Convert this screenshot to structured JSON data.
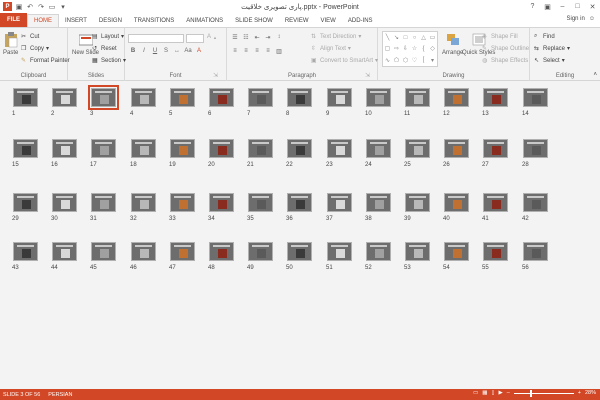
{
  "window": {
    "title": "پاری تصویری خلاقیت.pptx - PowerPoint"
  },
  "tabs": [
    {
      "label": "FILE"
    },
    {
      "label": "HOME"
    },
    {
      "label": "INSERT"
    },
    {
      "label": "DESIGN"
    },
    {
      "label": "TRANSITIONS"
    },
    {
      "label": "ANIMATIONS"
    },
    {
      "label": "SLIDE SHOW"
    },
    {
      "label": "REVIEW"
    },
    {
      "label": "VIEW"
    },
    {
      "label": "ADD-INS"
    }
  ],
  "signin": "Sign in",
  "ribbon": {
    "clipboard": {
      "label": "Clipboard",
      "paste": "Paste",
      "cut": "Cut",
      "copy": "Copy",
      "format_painter": "Format Painter"
    },
    "slides": {
      "label": "Slides",
      "new_slide": "New Slide",
      "layout": "Layout",
      "reset": "Reset",
      "section": "Section"
    },
    "font": {
      "label": "Font"
    },
    "paragraph": {
      "label": "Paragraph",
      "text_direction": "Text Direction",
      "align_text": "Align Text",
      "convert": "Convert to SmartArt"
    },
    "drawing": {
      "label": "Drawing",
      "arrange": "Arrange",
      "quick_styles": "Quick Styles",
      "shape_fill": "Shape Fill",
      "shape_outline": "Shape Outline",
      "shape_effects": "Shape Effects"
    },
    "editing": {
      "label": "Editing",
      "find": "Find",
      "replace": "Replace",
      "select": "Select"
    }
  },
  "slides": {
    "selected": 3,
    "numbers": [
      "1",
      "2",
      "3",
      "4",
      "5",
      "6",
      "7",
      "8",
      "9",
      "10",
      "11",
      "12",
      "13",
      "14",
      "15",
      "16",
      "17",
      "18",
      "19",
      "20",
      "21",
      "22",
      "23",
      "24",
      "25",
      "26",
      "27",
      "28",
      "29",
      "30",
      "31",
      "32",
      "33",
      "34",
      "35",
      "36",
      "37",
      "38",
      "39",
      "40",
      "41",
      "42",
      "43",
      "44",
      "45",
      "46",
      "47",
      "48",
      "49",
      "50",
      "51",
      "52",
      "53",
      "54",
      "55",
      "56"
    ]
  },
  "status": {
    "slide_of": "SLIDE 3 OF 56",
    "language": "PERSIAN",
    "zoom": "28%"
  },
  "colors": {
    "accent": "#d24726",
    "ribbon_bg": "#f3f3f3",
    "thumb_bg": "#6d6d6d"
  }
}
